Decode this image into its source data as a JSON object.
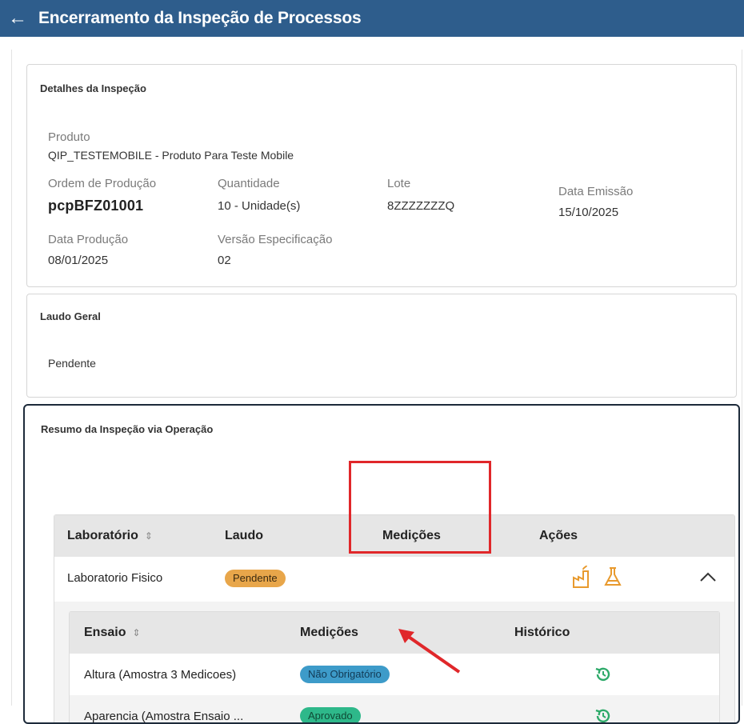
{
  "header": {
    "title": "Encerramento da Inspeção de Processos",
    "back_icon": "arrow-left-icon"
  },
  "details": {
    "title": "Detalhes da Inspeção",
    "produto_label": "Produto",
    "produto_value": "QIP_TESTEMOBILE - Produto Para Teste Mobile",
    "ordem_label": "Ordem de Produção",
    "ordem_value": "pcpBFZ01001",
    "quantidade_label": "Quantidade",
    "quantidade_value": "10 - Unidade(s)",
    "lote_label": "Lote",
    "lote_value": "8ZZZZZZZQ",
    "emissao_label": "Data Emissão",
    "emissao_value": "15/10/2025",
    "producao_label": "Data Produção",
    "producao_value": "08/01/2025",
    "versao_label": "Versão Especificação",
    "versao_value": "02"
  },
  "laudo": {
    "title": "Laudo Geral",
    "value": "Pendente"
  },
  "resumo": {
    "title": "Resumo da Inspeção via Operação",
    "columns": {
      "laboratorio": "Laboratório",
      "laudo": "Laudo",
      "medicoes": "Medições",
      "acoes": "Ações"
    },
    "row": {
      "laboratorio": "Laboratorio Fisico",
      "laudo": "Pendente"
    },
    "sub_columns": {
      "ensaio": "Ensaio",
      "medicoes": "Medições",
      "historico": "Histórico"
    },
    "sub_rows": [
      {
        "ensaio": "Altura (Amostra 3 Medicoes)",
        "medicoes": "Não Obrigatório"
      },
      {
        "ensaio": "Aparencia (Amostra Ensaio ...",
        "medicoes": "Aprovado"
      }
    ]
  },
  "colors": {
    "header": "#2e5d8c",
    "pending": "#e8a64a",
    "not_required": "#3d9bc9",
    "approved": "#2eb88a",
    "action_icon": "#e89a2e",
    "history_icon": "#2eaa6a",
    "annotation": "#e0272a"
  }
}
